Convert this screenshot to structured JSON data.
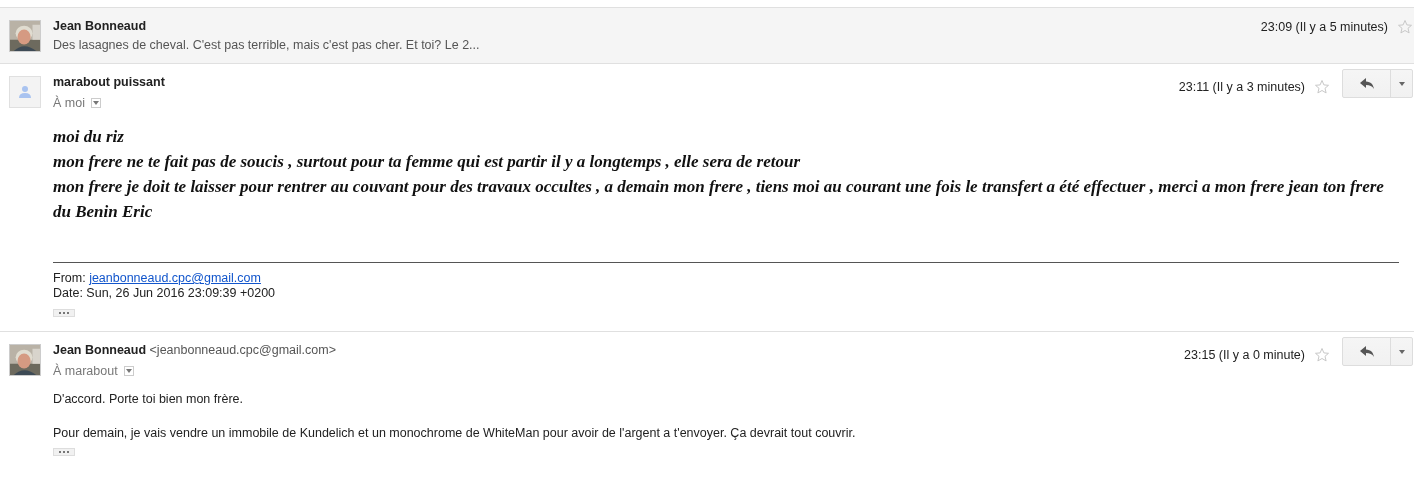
{
  "messages": [
    {
      "kind": "collapsed",
      "sender": "Jean Bonneaud",
      "snippet": "Des lasagnes de cheval. C'est pas terrible, mais c'est pas cher. Et toi? Le 2...",
      "time": "23:09 (Il y a 5 minutes)",
      "starred": false
    },
    {
      "kind": "expanded",
      "avatar": {
        "kind": "default"
      },
      "sender": "marabout puissant",
      "recipient": "À moi",
      "time": "23:11 (Il y a 3 minutes)",
      "starred": false,
      "body": {
        "kind": "script",
        "paragraphs": [
          "moi du riz",
          "mon frere ne te fait pas de soucis , surtout pour ta femme qui est partir il y a longtemps , elle sera de retour",
          "mon frere je doit te laisser pour rentrer au couvant pour des travaux occultes , a demain mon frere , tiens moi au courant une fois le transfert a été effectuer , merci a mon frere jean ton frere du Benin Eric"
        ]
      },
      "quote": {
        "from_label": "From:",
        "from_link": "jeanbonneaud.cpc@gmail.com",
        "date": "Date: Sun, 26 Jun 2016 23:09:39 +0200"
      }
    },
    {
      "kind": "expanded",
      "sender": "Jean Bonneaud",
      "sender_email": "<jeanbonneaud.cpc@gmail.com>",
      "recipient": "À marabout",
      "time": "23:15 (Il y a 0 minute)",
      "starred": false,
      "body": {
        "kind": "plain",
        "paragraphs": [
          "D'accord. Porte toi bien mon frère.",
          "Pour demain, je vais vendre un immobile de Kundelich et un monochrome de WhiteMan pour avoir de l'argent a t'envoyer. Ça devrait tout couvrir."
        ]
      }
    }
  ]
}
